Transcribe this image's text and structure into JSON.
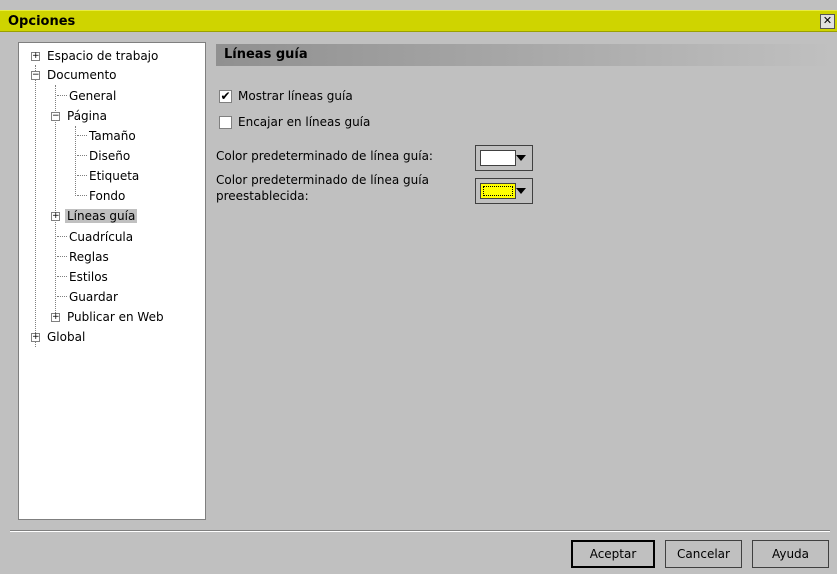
{
  "window": {
    "title": "Opciones"
  },
  "tree": {
    "items": [
      {
        "label": "Espacio de trabajo",
        "expander": "+"
      },
      {
        "label": "Documento",
        "expander": "−"
      },
      {
        "label": "General"
      },
      {
        "label": "Página",
        "expander": "−"
      },
      {
        "label": "Tamaño"
      },
      {
        "label": "Diseño"
      },
      {
        "label": "Etiqueta"
      },
      {
        "label": "Fondo"
      },
      {
        "label": "Líneas guía",
        "expander": "+",
        "selected": true
      },
      {
        "label": "Cuadrícula"
      },
      {
        "label": "Reglas"
      },
      {
        "label": "Estilos"
      },
      {
        "label": "Guardar"
      },
      {
        "label": "Publicar en Web",
        "expander": "+"
      },
      {
        "label": "Global",
        "expander": "+"
      }
    ]
  },
  "panel": {
    "header": "Líneas guía",
    "show_guides": {
      "label": "Mostrar líneas guía",
      "checked": true,
      "mark": "✔"
    },
    "snap_guides": {
      "label": "Encajar en líneas guía",
      "checked": false
    },
    "default_color": {
      "label": "Color predeterminado de línea guía:",
      "color": "#ffffff"
    },
    "preset_color": {
      "label_line1": "Color predeterminado de línea guía",
      "label_line2": "preestablecida:",
      "color": "#ffff00"
    }
  },
  "buttons": {
    "ok": "Aceptar",
    "cancel": "Cancelar",
    "help": "Ayuda"
  },
  "colors": {
    "titlebar": "#cfd400",
    "dialog": "#c0c0c0"
  }
}
